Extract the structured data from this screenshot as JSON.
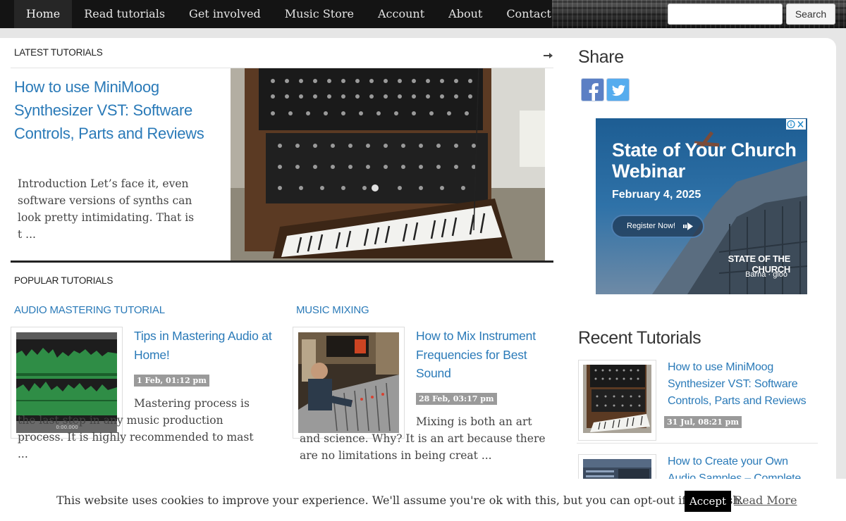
{
  "nav": {
    "items": [
      {
        "label": "Home",
        "active": true
      },
      {
        "label": "Read tutorials"
      },
      {
        "label": "Get involved"
      },
      {
        "label": "Music Store"
      },
      {
        "label": "Account"
      },
      {
        "label": "About"
      },
      {
        "label": "Contact"
      }
    ],
    "search_placeholder": "",
    "search_button": "Search"
  },
  "latest": {
    "section_label": "LATEST TUTORIALS",
    "arrow_icon": "arrow-right-icon",
    "title": "How to use MiniMoog Synthesizer VST: Software Controls, Parts and Reviews",
    "excerpt": "Introduction Let’s face it, even software versions of synths can look pretty intimidating. That is t ..."
  },
  "popular": {
    "section_label": "POPULAR TUTORIALS",
    "columns": [
      {
        "category": "AUDIO MASTERING TUTORIAL",
        "title": "Tips in Mastering Audio at Home!",
        "date": "1 Feb, 01:12 pm",
        "excerpt": "Mastering process is the last step in any music production process. It is highly recommended to mast ...",
        "thumb_caption": "0:00.000"
      },
      {
        "category": "MUSIC MIXING",
        "title": "How to Mix Instrument Frequencies for Best Sound",
        "date": "28 Feb, 03:17 pm",
        "excerpt": "Mixing is both an art and science. Why? It is an art because there are no limitations in being creat ..."
      }
    ]
  },
  "sidebar": {
    "share_heading": "Share",
    "share_icons": [
      "facebook-icon",
      "twitter-icon"
    ],
    "ad": {
      "title": "State of Your Church Webinar",
      "date": "February 4, 2025",
      "button": "Register Now!",
      "brand": "STATE OF THE CHURCH",
      "sub": "Barna · gloo"
    },
    "recent_heading": "Recent Tutorials",
    "recent": [
      {
        "title": "How to use MiniMoog Synthesizer VST: Software Controls, Parts and Reviews",
        "date": "31 Jul, 08:21 pm"
      },
      {
        "title": "How to Create your Own Audio Samples – Complete"
      }
    ]
  },
  "cookie": {
    "text": "This website uses cookies to improve your experience. We'll assume you're ok with this, but you can opt-out if you wish.",
    "accept": "Accept",
    "read_more": "Read More"
  },
  "colors": {
    "link": "#2a7ab8",
    "nav_bg": "#141414",
    "badge": "#9a9a9a"
  }
}
